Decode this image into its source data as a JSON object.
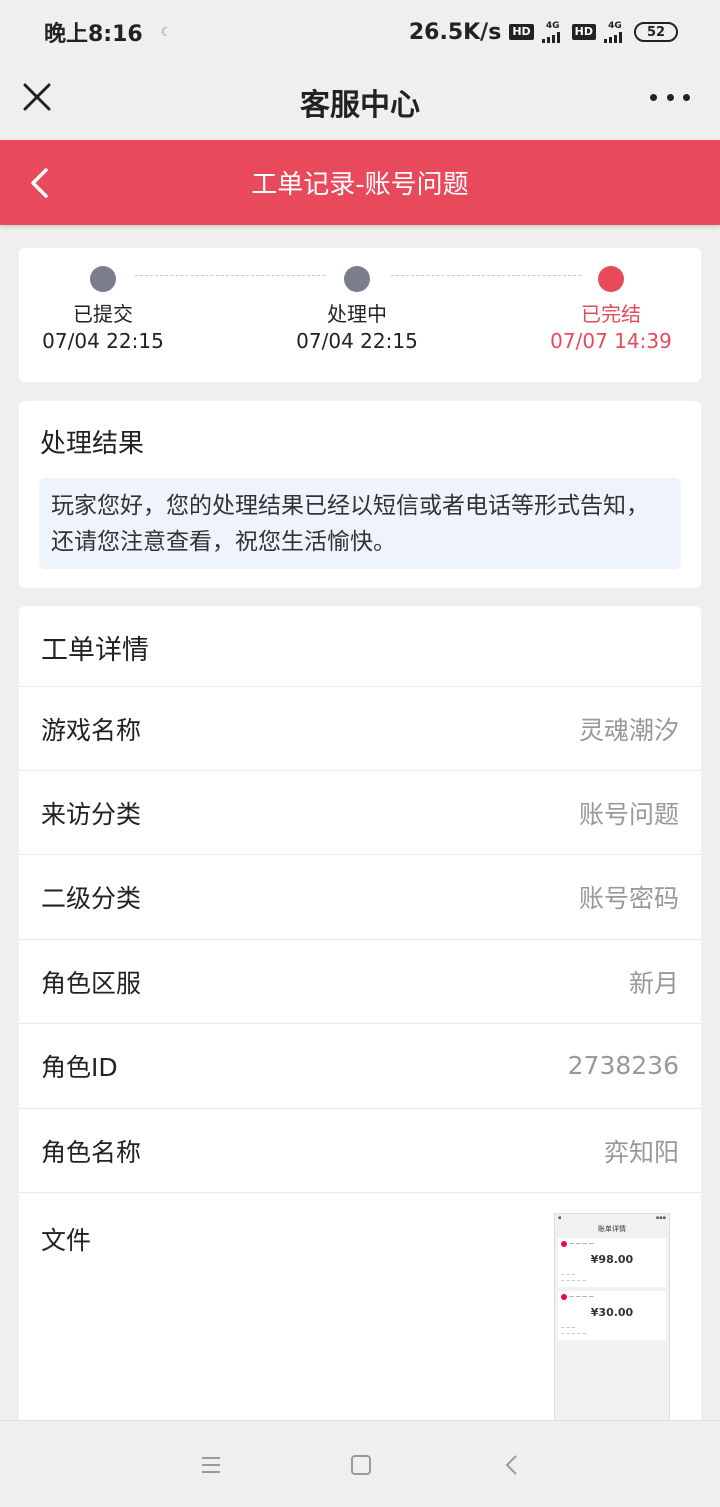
{
  "status_bar": {
    "time": "晚上8:16",
    "net_speed": "26.5K/s",
    "hd1": "HD",
    "hd2": "HD",
    "net1": "4G",
    "net2": "4G",
    "battery": "52"
  },
  "title_bar": {
    "title": "客服中心"
  },
  "header": {
    "title": "工单记录-账号问题",
    "color": "#e84a5b"
  },
  "progress": {
    "steps": [
      {
        "label": "已提交",
        "time": "07/04 22:15",
        "state": "done-gray"
      },
      {
        "label": "处理中",
        "time": "07/04 22:15",
        "state": "done-gray"
      },
      {
        "label": "已完结",
        "time": "07/07 14:39",
        "state": "current-red"
      }
    ]
  },
  "result": {
    "title": "处理结果",
    "text": "玩家您好，您的处理结果已经以短信或者电话等形式告知，还请您注意查看，祝您生活愉快。"
  },
  "details": {
    "title": "工单详情",
    "rows": [
      {
        "label": "游戏名称",
        "value": "灵魂潮汐"
      },
      {
        "label": "来访分类",
        "value": "账号问题"
      },
      {
        "label": "二级分类",
        "value": "账号密码"
      },
      {
        "label": "角色区服",
        "value": "新月"
      },
      {
        "label": "角色ID",
        "value": "2738236"
      },
      {
        "label": "角色名称",
        "value": "弈知阳"
      }
    ],
    "file_label": "文件",
    "thumbnail": {
      "title": "账单详情",
      "amount1": "¥98.00",
      "amount2": "¥30.00"
    }
  }
}
